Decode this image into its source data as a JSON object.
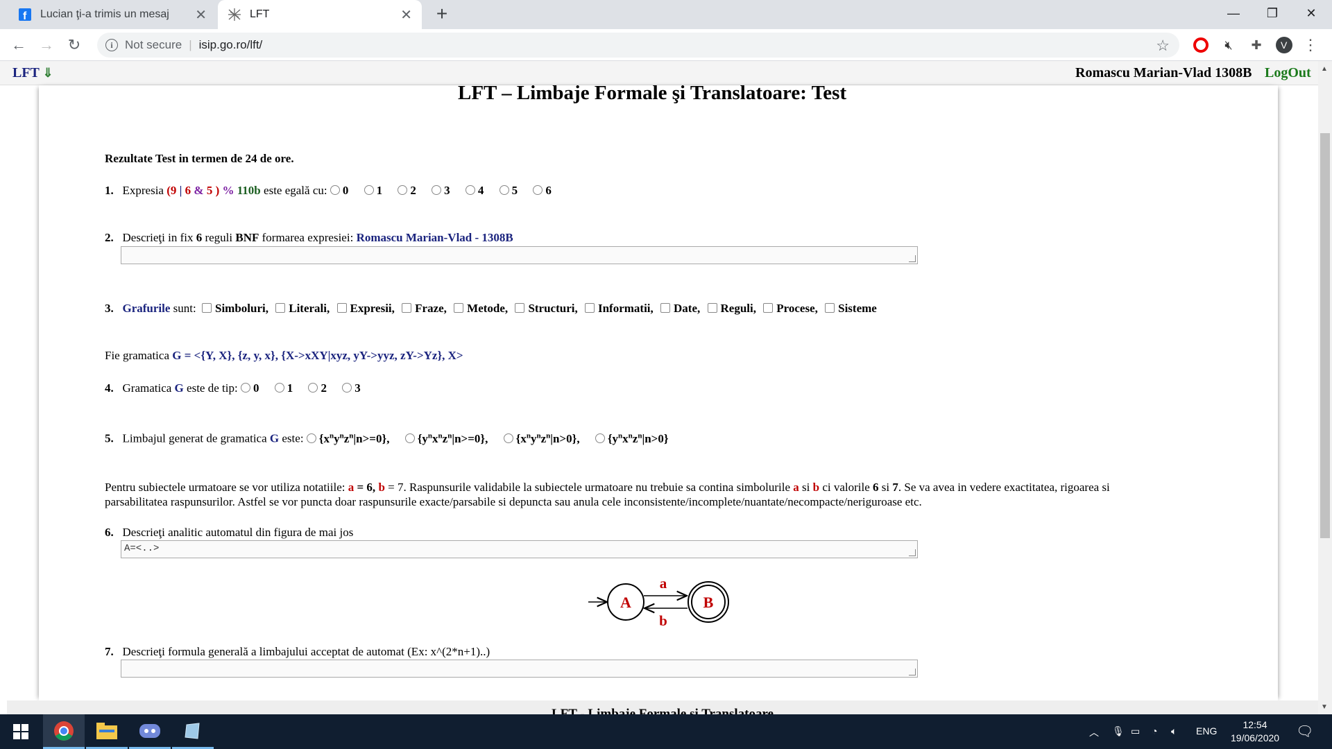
{
  "browser": {
    "tabs": [
      {
        "label": "Lucian ţi-a trimis un mesaj",
        "icon": "facebook-icon"
      },
      {
        "label": "LFT",
        "icon": "lft-favicon-icon"
      }
    ],
    "security_label": "Not secure",
    "url": "isip.go.ro/lft/"
  },
  "header": {
    "logo": "LFT",
    "logo_arrow": "⇓",
    "user": "Romascu Marian-Vlad 1308B",
    "logout": "LogOut"
  },
  "page_title": "LFT – Limbaje Formale şi Translatoare: Test",
  "results_note": "Rezultate Test in termen de 24 de ore.",
  "q1": {
    "num": "1.",
    "pre": "Expresia",
    "p_open": "(",
    "v9": "9",
    "op_or": "|",
    "v6": "6",
    "op_and": "&",
    "v5": "5",
    "p_close": ")",
    "op_mod": "%",
    "v110b": "110b",
    "post": "este egală cu:",
    "options": [
      "0",
      "1",
      "2",
      "3",
      "4",
      "5",
      "6"
    ]
  },
  "q2": {
    "num": "2.",
    "pre": "Descrieţi in fix",
    "count": "6",
    "mid": "reguli",
    "bnf": "BNF",
    "post": "formarea expresiei:",
    "name": "Romascu Marian-Vlad - 1308B"
  },
  "q3": {
    "num": "3.",
    "subject": "Grafurile",
    "verb": "sunt:",
    "options": [
      "Simboluri,",
      "Literali,",
      "Expresii,",
      "Fraze,",
      "Metode,",
      "Structuri,",
      "Informatii,",
      "Date,",
      "Reguli,",
      "Procese,",
      "Sisteme"
    ]
  },
  "grammar": {
    "pre": "Fie gramatica",
    "def": "G = <{Y, X}, {z, y, x}, {X->xXY|xyz, yY->yyz, zY->Yz}, X>"
  },
  "q4": {
    "num": "4.",
    "pre": "Gramatica",
    "g": "G",
    "post": "este de tip:",
    "options": [
      "0",
      "1",
      "2",
      "3"
    ]
  },
  "q5": {
    "num": "5.",
    "pre": "Limbajul generat de gramatica",
    "g": "G",
    "post": "este:",
    "sup": "n",
    "options": [
      {
        "open": "{",
        "a": "x",
        "b": "y",
        "c": "z",
        "close": "|n>=0},"
      },
      {
        "open": "{",
        "a": "y",
        "b": "x",
        "c": "z",
        "close": "|n>=0},"
      },
      {
        "open": "{",
        "a": "x",
        "b": "y",
        "c": "z",
        "close": "|n>0},"
      },
      {
        "open": "{",
        "a": "y",
        "b": "x",
        "c": "z",
        "close": "|n>0}"
      }
    ]
  },
  "notes": {
    "p1": "Pentru subiectele urmatoare se vor utiliza notatiile:",
    "a": "a",
    "eq6": "= 6,",
    "b": "b",
    "eq7": "= 7. Raspunsurile validabile la subiectele urmatoare nu trebuie sa contina simbolurile",
    "a2": "a",
    "si": "si",
    "b2": "b",
    "ci": "ci valorile",
    "six": "6",
    "si2": "si",
    "seven": "7",
    "rest": ". Se va avea in vedere exactitatea, rigoarea si",
    "line2": "parsabilitatea raspunsurilor. Astfel se vor puncta doar raspunsurile exacte/parsabile si depuncta sau anula cele inconsistente/incomplete/nuantate/necompacte/neriguroase etc."
  },
  "q6": {
    "num": "6.",
    "text": "Descrieţi analitic automatul din figura de mai jos",
    "value": "A=<..>"
  },
  "automaton": {
    "state_a": "A",
    "state_b": "B",
    "label_top": "a",
    "label_bottom": "b"
  },
  "q7": {
    "num": "7.",
    "text": "Descrieţi formula generală a limbajului acceptat de automat (Ex: x^(2*n+1)..)"
  },
  "footer": "LFT - Limbaje Formale şi Translatoare",
  "taskbar": {
    "lang": "ENG",
    "time": "12:54",
    "date": "19/06/2020"
  },
  "colors": {
    "accent_blue": "#1a237e",
    "accent_red": "#c00000",
    "accent_green": "#1b7a1b",
    "taskbar": "#101e30"
  }
}
